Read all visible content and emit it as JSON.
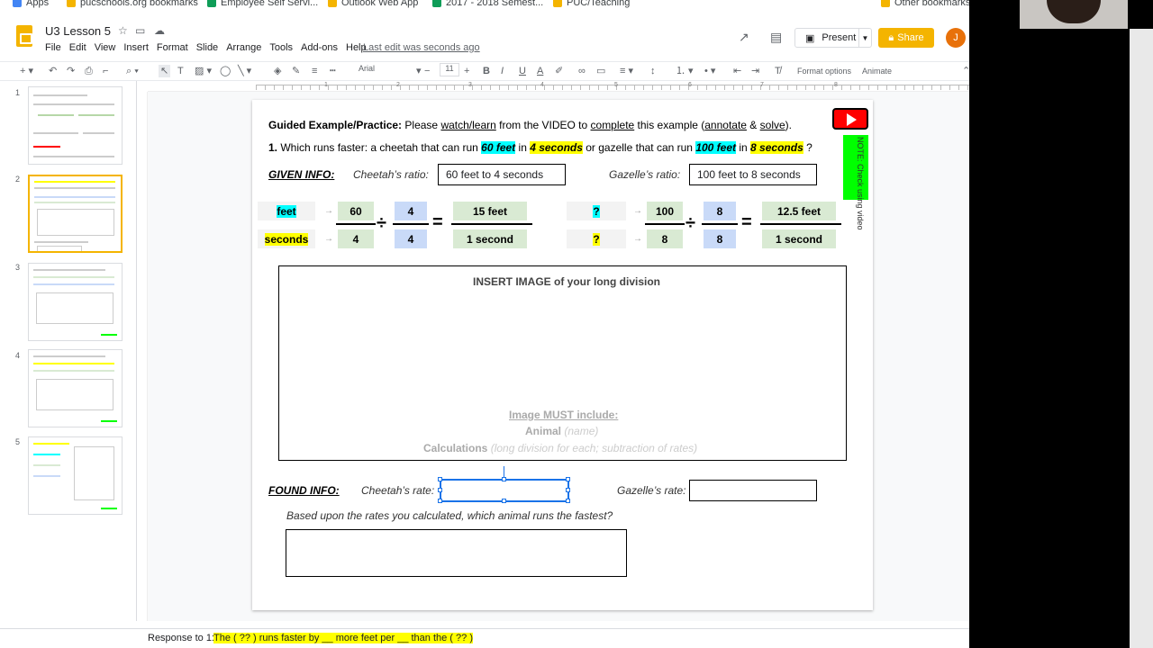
{
  "bookmarks": [
    "Apps",
    "pucschools.org bookmarks",
    "Employee Self Servi...",
    "Outlook Web App",
    "2017 - 2018 Semest...",
    "PUC/Teaching",
    "Other bookmarks"
  ],
  "doc": {
    "title": "U3 Lesson 5",
    "last_edit": "Last edit was seconds ago"
  },
  "menu": [
    "File",
    "Edit",
    "View",
    "Insert",
    "Format",
    "Slide",
    "Arrange",
    "Tools",
    "Add-ons",
    "Help"
  ],
  "header": {
    "present": "Present",
    "share": "Share",
    "avatar": "J"
  },
  "toolbar": {
    "font": "Arial",
    "size": "11",
    "format_options": "Format options",
    "animate": "Animate"
  },
  "ruler": [
    "1",
    "2",
    "3",
    "4",
    "5",
    "6",
    "7",
    "8"
  ],
  "slides": [
    "1",
    "2",
    "3",
    "4",
    "5"
  ],
  "slide": {
    "heading": {
      "label": "Guided Example/Practice:",
      "p1": "Please ",
      "watch": "watch/learn",
      "p2": " from the VIDEO to ",
      "complete": "complete",
      "p3": " this example (",
      "annotate": "annotate",
      "amp": " & ",
      "solve": "solve",
      "p4": ")."
    },
    "q": {
      "num": "1.",
      "p1": "Which runs faster:  a cheetah that can run ",
      "h1": "60 feet",
      "p2": " in ",
      "h2": "4 seconds",
      "p3": " or gazelle that can run ",
      "h3": "100 feet",
      "p4": " in ",
      "h4": "8 seconds",
      "p5": " ?"
    },
    "given": {
      "label": "GIVEN INFO:",
      "cheetah_label": "Cheetah’s ratio:",
      "cheetah_value": "60 feet to 4 seconds",
      "gazelle_label": "Gazelle’s ratio:",
      "gazelle_value": "100 feet to 8 seconds"
    },
    "note": "NOTE: Check using video",
    "cheetah_calc": {
      "unit_top": "feet",
      "unit_bottom": "seconds",
      "num": "60",
      "den": "4",
      "div_top": "4",
      "div_bottom": "4",
      "result_top": "15 feet",
      "result_bottom": "1 second"
    },
    "gazelle_calc": {
      "unit_top": "?",
      "unit_bottom": "?",
      "num": "100",
      "den": "8",
      "div_top": "8",
      "div_bottom": "8",
      "result_top": "12.5 feet",
      "result_bottom": "1 second"
    },
    "image_box": {
      "title": "INSERT IMAGE of your long division",
      "must": "Image MUST include:",
      "animal": "Animal",
      "animal_note": "(name)",
      "calc": "Calculations",
      "calc_note": "(long division for each; subtraction of rates)"
    },
    "found": {
      "label": "FOUND INFO:",
      "cheetah_label": "Cheetah’s rate:",
      "gazelle_label": "Gazelle’s rate:"
    },
    "question": "Based upon the rates you calculated, which animal runs the fastest?"
  },
  "status": {
    "label": "Response to 1:",
    "text": "The ( ?? ) runs faster by __ more feet per __ than the ( ?? )"
  },
  "colors": {
    "accent": "#f4b400",
    "cyan": "#00ffff",
    "yellow": "#ffff00",
    "green_cell": "#d9ead3",
    "blue_cell": "#c9daf8",
    "play": "#ff0000",
    "note": "#00ff00"
  }
}
